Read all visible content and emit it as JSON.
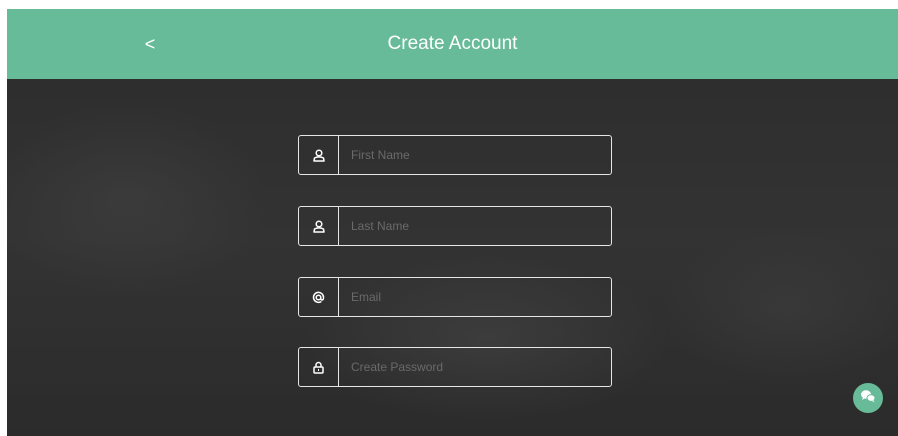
{
  "header": {
    "back_icon": "chevron-left-icon",
    "back_label": "<",
    "title": "Create Account",
    "color": "#67bb98"
  },
  "form": {
    "fields": [
      {
        "icon": "user-icon",
        "placeholder": "First Name",
        "value": ""
      },
      {
        "icon": "user-icon",
        "placeholder": "Last Name",
        "value": ""
      },
      {
        "icon": "at-sign-icon",
        "placeholder": "Email",
        "value": ""
      },
      {
        "icon": "lock-icon",
        "placeholder": "Create Password",
        "value": ""
      }
    ]
  },
  "chat_widget": {
    "icon": "chat-bubbles-icon",
    "color": "#67bb98"
  }
}
